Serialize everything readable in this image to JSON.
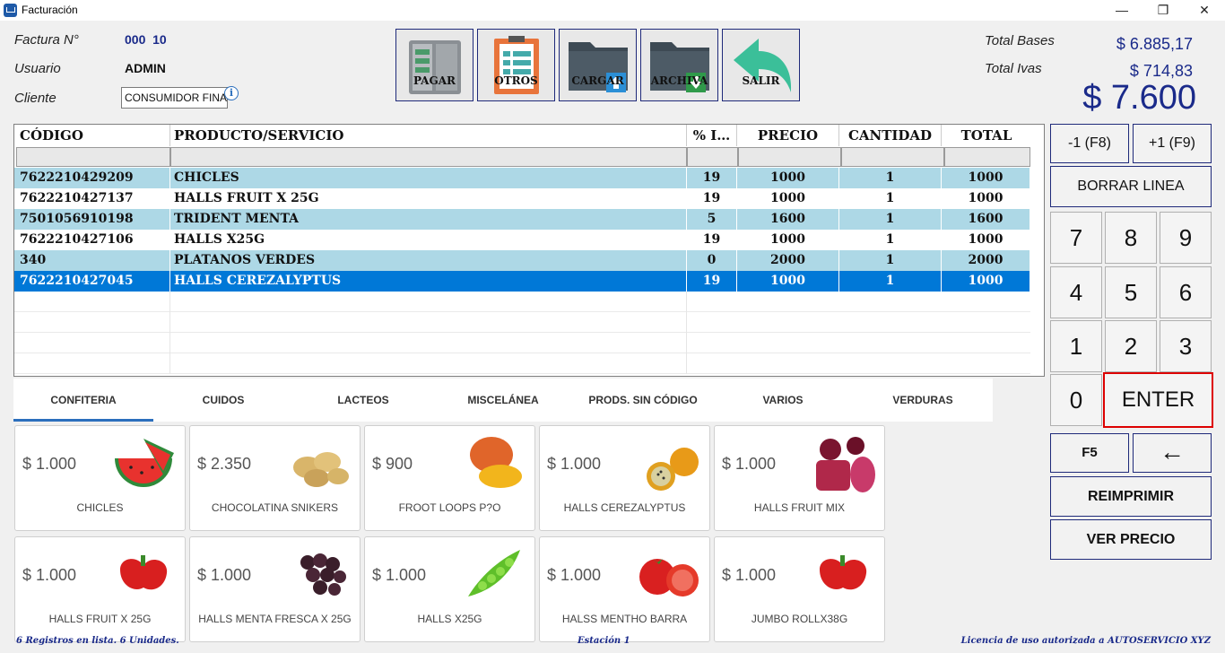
{
  "window": {
    "title": "Facturación",
    "minimize": "—",
    "maximize": "❐",
    "close": "✕"
  },
  "header": {
    "factura_label": "Factura N°",
    "factura_value": "000  10",
    "usuario_label": "Usuario",
    "usuario_value": "ADMIN",
    "cliente_label": "Cliente",
    "cliente_value": "CONSUMIDOR FINAL",
    "info": "i"
  },
  "toolbar": {
    "pagar": "PAGAR",
    "otros": "OTROS",
    "cargar": "CARGAR",
    "archiva": "ARCHIVA",
    "salir": "SALIR"
  },
  "totals": {
    "bases_label": "Total Bases",
    "bases_value": "$ 6.885,17",
    "ivas_label": "Total Ivas",
    "ivas_value": "$ 714,83",
    "total_value": "$ 7.600"
  },
  "grid": {
    "headers": {
      "codigo": "CÓDIGO",
      "producto": "PRODUCTO/SERVICIO",
      "iva": "% I…",
      "precio": "PRECIO",
      "cantidad": "CANTIDAD",
      "total": "TOTAL"
    },
    "rows": [
      {
        "codigo": "7622210429209",
        "producto": "CHICLES",
        "iva": "19",
        "precio": "1000",
        "cantidad": "1",
        "total": "1000"
      },
      {
        "codigo": "7622210427137",
        "producto": "HALLS FRUIT X 25G",
        "iva": "19",
        "precio": "1000",
        "cantidad": "1",
        "total": "1000"
      },
      {
        "codigo": "7501056910198",
        "producto": "TRIDENT MENTA",
        "iva": "5",
        "precio": "1600",
        "cantidad": "1",
        "total": "1600"
      },
      {
        "codigo": "7622210427106",
        "producto": "HALLS X25G",
        "iva": "19",
        "precio": "1000",
        "cantidad": "1",
        "total": "1000"
      },
      {
        "codigo": "340",
        "producto": "PLATANOS VERDES",
        "iva": "0",
        "precio": "2000",
        "cantidad": "1",
        "total": "2000"
      },
      {
        "codigo": "7622210427045",
        "producto": "HALLS CEREZALYPTUS",
        "iva": "19",
        "precio": "1000",
        "cantidad": "1",
        "total": "1000"
      }
    ]
  },
  "tabs": [
    "CONFITERIA",
    "CUIDOS",
    "LACTEOS",
    "MISCELÁNEA",
    "PRODS. SIN CÓDIGO",
    "VARIOS",
    "VERDURAS"
  ],
  "products": [
    {
      "price": "$ 1.000",
      "name": "CHICLES",
      "icon": "watermelon-icon"
    },
    {
      "price": "$ 2.350",
      "name": "CHOCOLATINA SNIKERS",
      "icon": "potato-icon"
    },
    {
      "price": "$ 900",
      "name": "FROOT LOOPS P?O",
      "icon": "mango-icon"
    },
    {
      "price": "$ 1.000",
      "name": "HALLS CEREZALYPTUS",
      "icon": "passionfruit-icon"
    },
    {
      "price": "$ 1.000",
      "name": "HALLS FRUIT MIX",
      "icon": "beet-icon"
    },
    {
      "price": "$ 1.000",
      "name": "HALLS FRUIT X 25G",
      "icon": "pepper-icon"
    },
    {
      "price": "$ 1.000",
      "name": "HALLS MENTA FRESCA X 25G",
      "icon": "grapes-icon"
    },
    {
      "price": "$ 1.000",
      "name": "HALLS X25G",
      "icon": "peas-icon"
    },
    {
      "price": "$ 1.000",
      "name": "HALSS MENTHO BARRA",
      "icon": "tomato-icon"
    },
    {
      "price": "$ 1.000",
      "name": "JUMBO ROLLX38G",
      "icon": "pepper-icon"
    }
  ],
  "keypad": {
    "minus": "-1 (F8)",
    "plus": "+1 (F9)",
    "borrar": "BORRAR LINEA",
    "k7": "7",
    "k8": "8",
    "k9": "9",
    "k4": "4",
    "k5": "5",
    "k6": "6",
    "k1": "1",
    "k2": "2",
    "k3": "3",
    "k0": "0",
    "enter": "ENTER",
    "f5": "F5",
    "back": "←",
    "reimprimir": "REIMPRIMIR",
    "ver_precio": "VER PRECIO"
  },
  "status": {
    "left": "6 Registros en lista. 6 Unidades.",
    "center": "Estación 1",
    "right": "Licencia de uso autorizada a AUTOSERVICIO XYZ"
  }
}
